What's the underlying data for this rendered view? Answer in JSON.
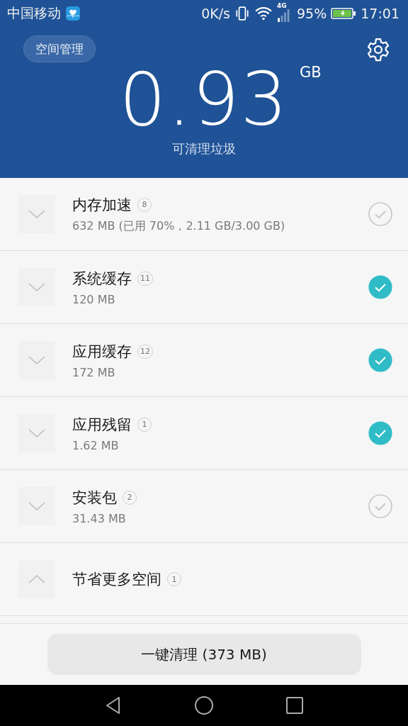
{
  "status_bar": {
    "carrier": "中国移动",
    "speed": "0K/s",
    "network": "4G",
    "battery": "95%",
    "time": "17:01"
  },
  "header": {
    "manage_button": "空间管理",
    "amount": "0.93",
    "unit": "GB",
    "caption": "可清理垃圾"
  },
  "items": [
    {
      "kind": "category",
      "title": "内存加速",
      "count": "8",
      "detail": "632 MB (已用 70%，2.11 GB/3.00 GB)",
      "expanded": false,
      "checked": false
    },
    {
      "kind": "category",
      "title": "系统缓存",
      "count": "11",
      "detail": "120 MB",
      "expanded": false,
      "checked": true
    },
    {
      "kind": "category",
      "title": "应用缓存",
      "count": "12",
      "detail": "172 MB",
      "expanded": false,
      "checked": true
    },
    {
      "kind": "category",
      "title": "应用残留",
      "count": "1",
      "detail": "1.62 MB",
      "expanded": false,
      "checked": true
    },
    {
      "kind": "category",
      "title": "安装包",
      "count": "2",
      "detail": "31.43 MB",
      "expanded": false,
      "checked": false
    },
    {
      "kind": "group",
      "title": "节省更多空间",
      "count": "1",
      "expanded": true
    }
  ],
  "clean_button": "一键清理 (373 MB)"
}
